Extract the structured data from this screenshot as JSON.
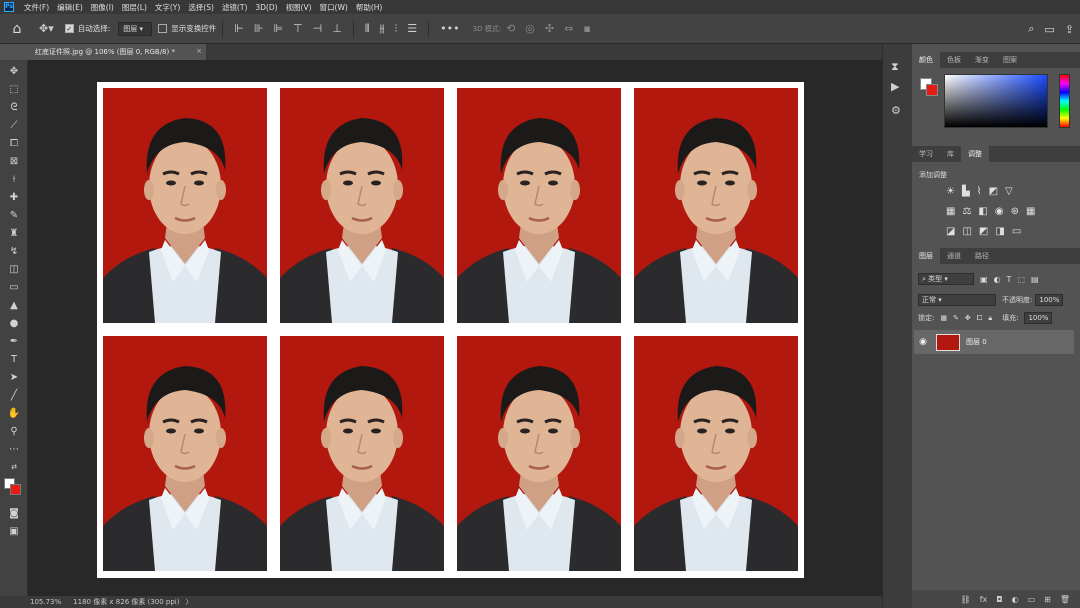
{
  "menu": {
    "logo": "Ps",
    "items": [
      "文件(F)",
      "编辑(E)",
      "图像(I)",
      "图层(L)",
      "文字(Y)",
      "选择(S)",
      "滤镜(T)",
      "3D(D)",
      "视图(V)",
      "窗口(W)",
      "帮助(H)"
    ]
  },
  "options": {
    "auto_select_label": "自动选择:",
    "auto_select_value": "图层",
    "show_transform_label": "显示变换控件",
    "mode_3d_label": "3D 模式:"
  },
  "document": {
    "tab_title": "红底证件照.jpg @ 106% (图层 0, RGB/8) *",
    "close": "×",
    "photo_bg_color": "#b3180f",
    "paper_color": "#ffffff",
    "grid_rows": 2,
    "grid_cols": 4
  },
  "status": {
    "zoom": "105.73%",
    "doc_info": "1180 像素 x 826 像素 (300 ppi)"
  },
  "panels": {
    "color_tabs": [
      "颜色",
      "色板",
      "渐变",
      "图案"
    ],
    "adjust_tabs": [
      "学习",
      "库",
      "调整"
    ],
    "adjust_title": "添加调整",
    "layer_tabs": [
      "图层",
      "通道",
      "路径"
    ],
    "kind_filter": "类型",
    "blend_mode": "正常",
    "opacity_label": "不透明度:",
    "opacity_value": "100%",
    "lock_label": "锁定:",
    "fill_label": "填充:",
    "fill_value": "100%",
    "layer_name": "图层 0",
    "foreground_color": "#ffffff",
    "background_color": "#e51b16"
  }
}
